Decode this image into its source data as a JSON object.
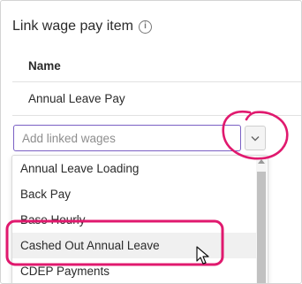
{
  "panel": {
    "title": "Link wage pay item",
    "info_icon": "info-icon"
  },
  "table": {
    "column_header": "Name",
    "rows": [
      "Annual Leave Pay"
    ]
  },
  "linked_wages": {
    "placeholder": "Add linked wages",
    "value": "",
    "toggle_icon": "chevron-down-icon"
  },
  "dropdown": {
    "options": [
      "Annual Leave Loading",
      "Back Pay",
      "Base Hourly",
      "Cashed Out Annual Leave",
      "CDEP Payments"
    ],
    "hovered_option": "Cashed Out Annual Leave"
  },
  "colors": {
    "accent": "#7a60c4",
    "highlight_annotation": "#e0196e"
  }
}
